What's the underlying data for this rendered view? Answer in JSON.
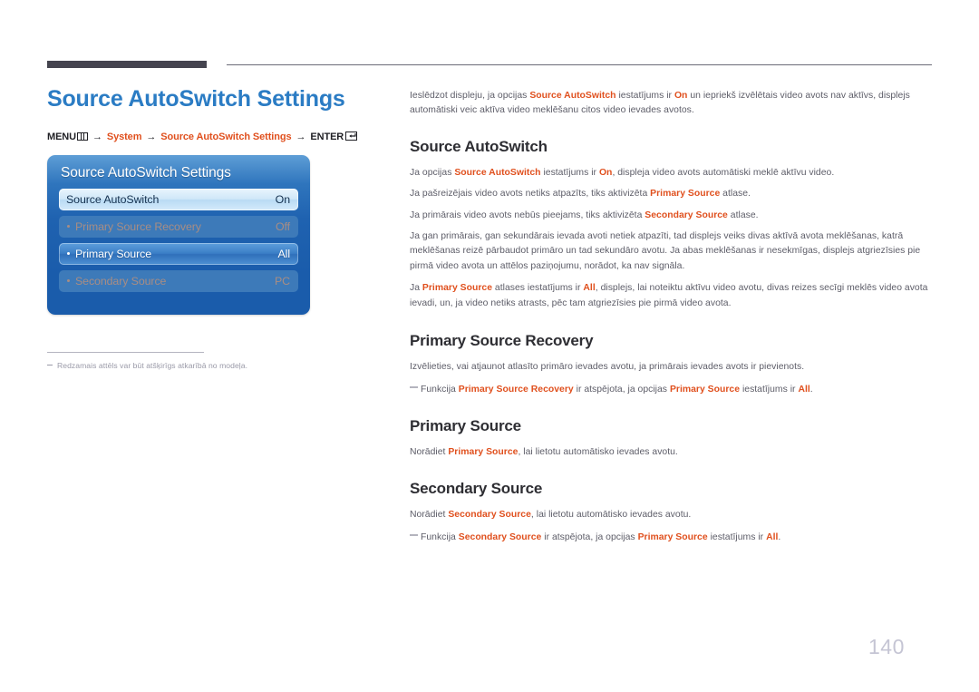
{
  "header": {
    "title": "Source AutoSwitch Settings"
  },
  "breadcrumb": {
    "menu_label": "MENU",
    "menu_icon": "menu-grid-icon",
    "arrow": "→",
    "item1": "System",
    "item2": "Source AutoSwitch Settings",
    "enter_label": "ENTER",
    "enter_icon": "enter-return-icon"
  },
  "osd": {
    "title": "Source AutoSwitch Settings",
    "rows": [
      {
        "label": "Source AutoSwitch",
        "value": "On",
        "state": "normal",
        "bullet": false
      },
      {
        "label": "Primary Source Recovery",
        "value": "Off",
        "state": "disabled",
        "bullet": true
      },
      {
        "label": "Primary Source",
        "value": "All",
        "state": "selected",
        "bullet": true
      },
      {
        "label": "Secondary Source",
        "value": "PC",
        "state": "disabled",
        "bullet": true
      }
    ]
  },
  "left_note": {
    "text": "Redzamais attēls var būt atšķirīgs atkarībā no modeļa."
  },
  "content": {
    "intro": {
      "p1_a": "Ieslēdzot displeju, ja opcijas ",
      "p1_kw1": "Source AutoSwitch",
      "p1_b": " iestatījums ir ",
      "p1_kw2": "On",
      "p1_c": " un iepriekš izvēlētais video avots nav aktīvs, displejs automātiski veic aktīva video meklēšanu citos video ievades avotos."
    },
    "sections": [
      {
        "heading": "Source AutoSwitch",
        "paras": [
          {
            "a": "Ja opcijas ",
            "kw1": "Source AutoSwitch",
            "b": " iestatījums ir ",
            "kw2": "On",
            "c": ", displeja video avots automātiski meklē aktīvu video."
          },
          {
            "a": "Ja pašreizējais video avots netiks atpazīts, tiks aktivizēta ",
            "kw1": "Primary Source",
            "c": " atlase."
          },
          {
            "a": "Ja primārais video avots nebūs pieejams, tiks aktivizēta ",
            "kw1": "Secondary Source",
            "c": " atlase."
          },
          {
            "a": "Ja gan primārais, gan sekundārais ievada avoti netiek atpazīti, tad displejs veiks divas aktīvā avota meklēšanas, katrā meklēšanas reizē pārbaudot primāro un tad sekundāro avotu. Ja abas meklēšanas ir nesekmīgas, displejs atgriezīsies pie pirmā video avota un attēlos paziņojumu, norādot, ka nav signāla."
          },
          {
            "a": "Ja ",
            "kw1": "Primary Source",
            "b": " atlases iestatījums ir ",
            "kw2": "All",
            "c": ", displejs, lai noteiktu aktīvu video avotu, divas reizes secīgi meklēs video avota ievadi, un, ja video netiks atrasts, pēc tam atgriezīsies pie pirmā video avota."
          }
        ]
      },
      {
        "heading": "Primary Source Recovery",
        "paras": [
          {
            "a": "Izvēlieties, vai atjaunot atlasīto primāro ievades avotu, ja primārais ievades avots ir pievienots."
          }
        ],
        "footnote": {
          "a": "Funkcija ",
          "kw1": "Primary Source Recovery",
          "b": " ir atspējota, ja opcijas ",
          "kw2": "Primary Source",
          "c": " iestatījums ir ",
          "kw3": "All",
          "d": "."
        }
      },
      {
        "heading": "Primary Source",
        "paras": [
          {
            "a": "Norādiet ",
            "kw1": "Primary Source",
            "c": ", lai lietotu automātisko ievades avotu."
          }
        ]
      },
      {
        "heading": "Secondary Source",
        "paras": [
          {
            "a": "Norādiet ",
            "kw1": "Secondary Source",
            "c": ", lai lietotu automātisko ievades avotu."
          }
        ],
        "footnote": {
          "a": "Funkcija ",
          "kw1": "Secondary Source",
          "b": " ir atspējota, ja opcijas ",
          "kw2": "Primary Source",
          "c": " iestatījums ir ",
          "kw3": "All",
          "d": "."
        }
      }
    ]
  },
  "page_number": "140",
  "colors": {
    "title_blue": "#2b7cc4",
    "keyword_orange": "#e0501e",
    "body_gray": "#5d5d68",
    "heading_dark": "#2e2e33",
    "osd_blue": "#1f62b0",
    "page_number_gray": "#c5c5d4"
  }
}
